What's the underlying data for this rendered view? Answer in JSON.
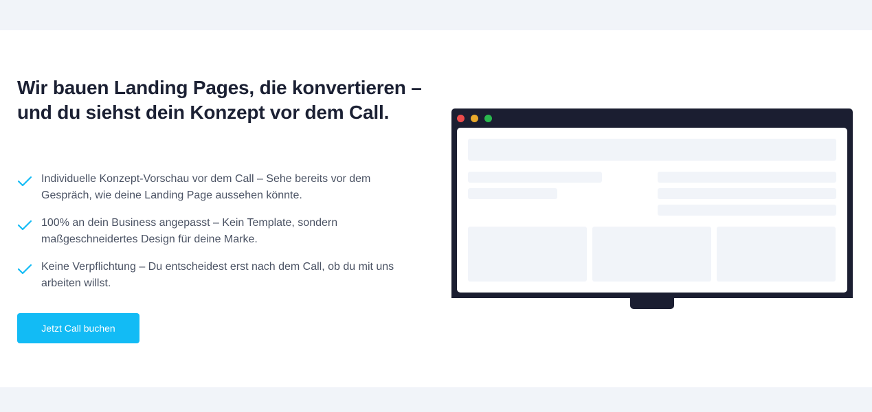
{
  "hero": {
    "headline": "Wir bauen Landing Pages, die konvertieren – und du siehst dein Konzept vor dem Call.",
    "features": [
      {
        "icon": "check-icon",
        "text": "Individuelle Konzept-Vorschau vor dem Call – Sehe bereits vor dem Gespräch, wie deine Landing Page aussehen könnte."
      },
      {
        "icon": "check-icon",
        "text": "100% an dein Business angepasst – Kein Template, sondern maßgeschneidertes Design für deine Marke."
      },
      {
        "icon": "check-icon",
        "text": "Keine Verpflichtung – Du entscheidest erst nach dem Call, ob du mit uns arbeiten willst."
      }
    ],
    "cta_label": "Jetzt Call buchen"
  },
  "colors": {
    "accent": "#12bbf5",
    "heading": "#1b2033",
    "body_text": "#4a5263",
    "mockup_frame": "#1b1e31",
    "placeholder": "#f1f4f9",
    "window_dots": [
      "#ea4b4b",
      "#e9a92b",
      "#2ab84e"
    ]
  }
}
